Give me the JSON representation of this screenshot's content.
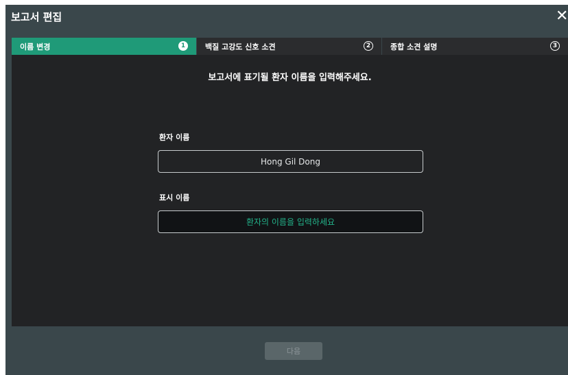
{
  "dialog": {
    "title": "보고서 편집",
    "close_glyph": "✕"
  },
  "tabs": [
    {
      "label": "이름 변경",
      "step": "1",
      "active": true
    },
    {
      "label": "백질 고강도 신호 소견",
      "step": "2",
      "active": false
    },
    {
      "label": "종합 소견 설명",
      "step": "3",
      "active": false
    }
  ],
  "instruction": "보고서에 표기될 환자 이름을 입력해주세요.",
  "patient_name": {
    "label": "환자 이름",
    "value": "Hong Gil Dong"
  },
  "display_name": {
    "label": "표시 이름",
    "placeholder": "환자의 이름을 입력하세요",
    "value": ""
  },
  "footer": {
    "next_label": "다음"
  },
  "colors": {
    "dialog_bg": "#3a474b",
    "accent": "#1f9a78",
    "content_bg": "#222325",
    "placeholder": "#23b38a"
  },
  "icons": {
    "close": "close-icon",
    "step_1": "step-1-icon",
    "step_2": "step-2-icon",
    "step_3": "step-3-icon"
  }
}
